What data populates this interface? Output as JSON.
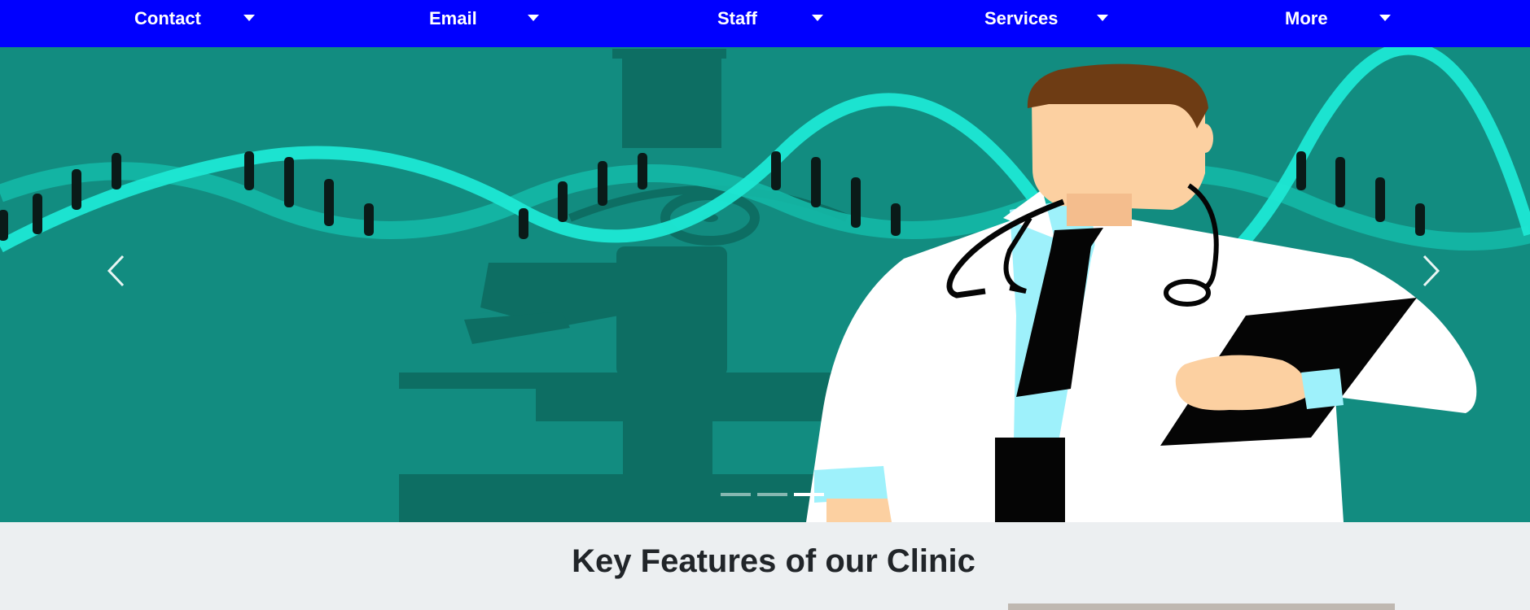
{
  "nav": {
    "items": [
      {
        "label": "Contact"
      },
      {
        "label": "Email"
      },
      {
        "label": "Staff"
      },
      {
        "label": "Services"
      },
      {
        "label": "More"
      }
    ]
  },
  "carousel": {
    "slide_count": 3,
    "active_slide": 3,
    "prev_icon": "chevron-left-icon",
    "next_icon": "chevron-right-icon"
  },
  "features": {
    "title": "Key Features of our Clinic"
  },
  "colors": {
    "nav_bg": "#0000ff",
    "hero_bg": "#128c80",
    "page_bg": "#eceff1"
  }
}
